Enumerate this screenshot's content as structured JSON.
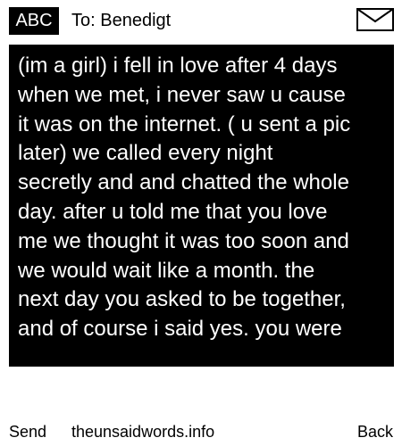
{
  "header": {
    "badge": "ABC",
    "recipient": "To: Benedigt",
    "icon": "envelope-icon"
  },
  "message": {
    "text": "(im a girl) i fell in love after 4 days\nwhen we met, i never saw u cause\nit was on the internet. ( u sent a pic\nlater) we called every night\nsecretly and and chatted the whole\nday. after u told me that you love\nme we thought it was too soon and\nwe would wait like a month. the\nnext day you asked to be together,\nand of course i said yes. you were"
  },
  "footer": {
    "send_label": "Send",
    "site_label": "theunsaidwords.info",
    "back_label": "Back"
  },
  "colors": {
    "background": "#ffffff",
    "message_background": "#000000",
    "message_text": "#ffffff",
    "text": "#000000"
  }
}
